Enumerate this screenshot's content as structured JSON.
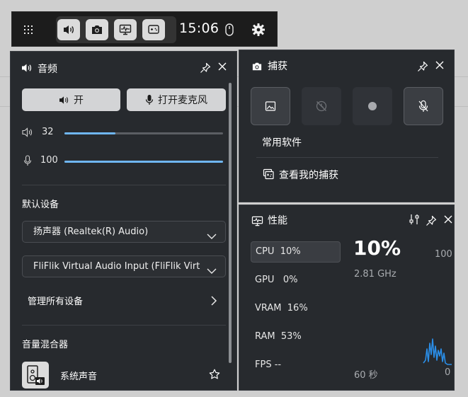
{
  "gamebar": {
    "time": "15:06",
    "buttons": [
      {
        "name": "audio",
        "icon": "speaker-icon"
      },
      {
        "name": "capture",
        "icon": "camera-icon"
      },
      {
        "name": "performance",
        "icon": "monitor-icon"
      },
      {
        "name": "xbox",
        "icon": "controller-icon"
      }
    ]
  },
  "audio": {
    "title": "音频",
    "on_label": "开",
    "mic_label": "打开麦克风",
    "speaker_volume": "32",
    "speaker_volume_value": 32,
    "mic_volume": "100",
    "mic_volume_value": 100,
    "default_device_label": "默认设备",
    "output_device": "扬声器 (Realtek(R) Audio)",
    "input_device": "FliFlik Virtual Audio Input (FliFlik Virt",
    "manage_label": "管理所有设备",
    "mixer_label": "音量混合器",
    "system_sound_label": "系统声音"
  },
  "capture": {
    "title": "捕获",
    "common_software": "常用软件",
    "view_captures": "查看我的捕获"
  },
  "performance": {
    "title": "性能",
    "metrics": [
      {
        "label": "CPU",
        "value": "10%"
      },
      {
        "label": "GPU",
        "value": "0%"
      },
      {
        "label": "VRAM",
        "value": "16%"
      },
      {
        "label": "RAM",
        "value": "53%"
      },
      {
        "label": "FPS",
        "value": "--"
      }
    ],
    "big_value": "10%",
    "frequency": "2.81 GHz",
    "scale_max": "100",
    "scale_min": "0",
    "duration": "60 秒"
  },
  "colors": {
    "accent": "#6fb6f2",
    "panel": "#272a2e",
    "bar": "#1c1c1c",
    "chart_line": "#2a8ee8"
  }
}
